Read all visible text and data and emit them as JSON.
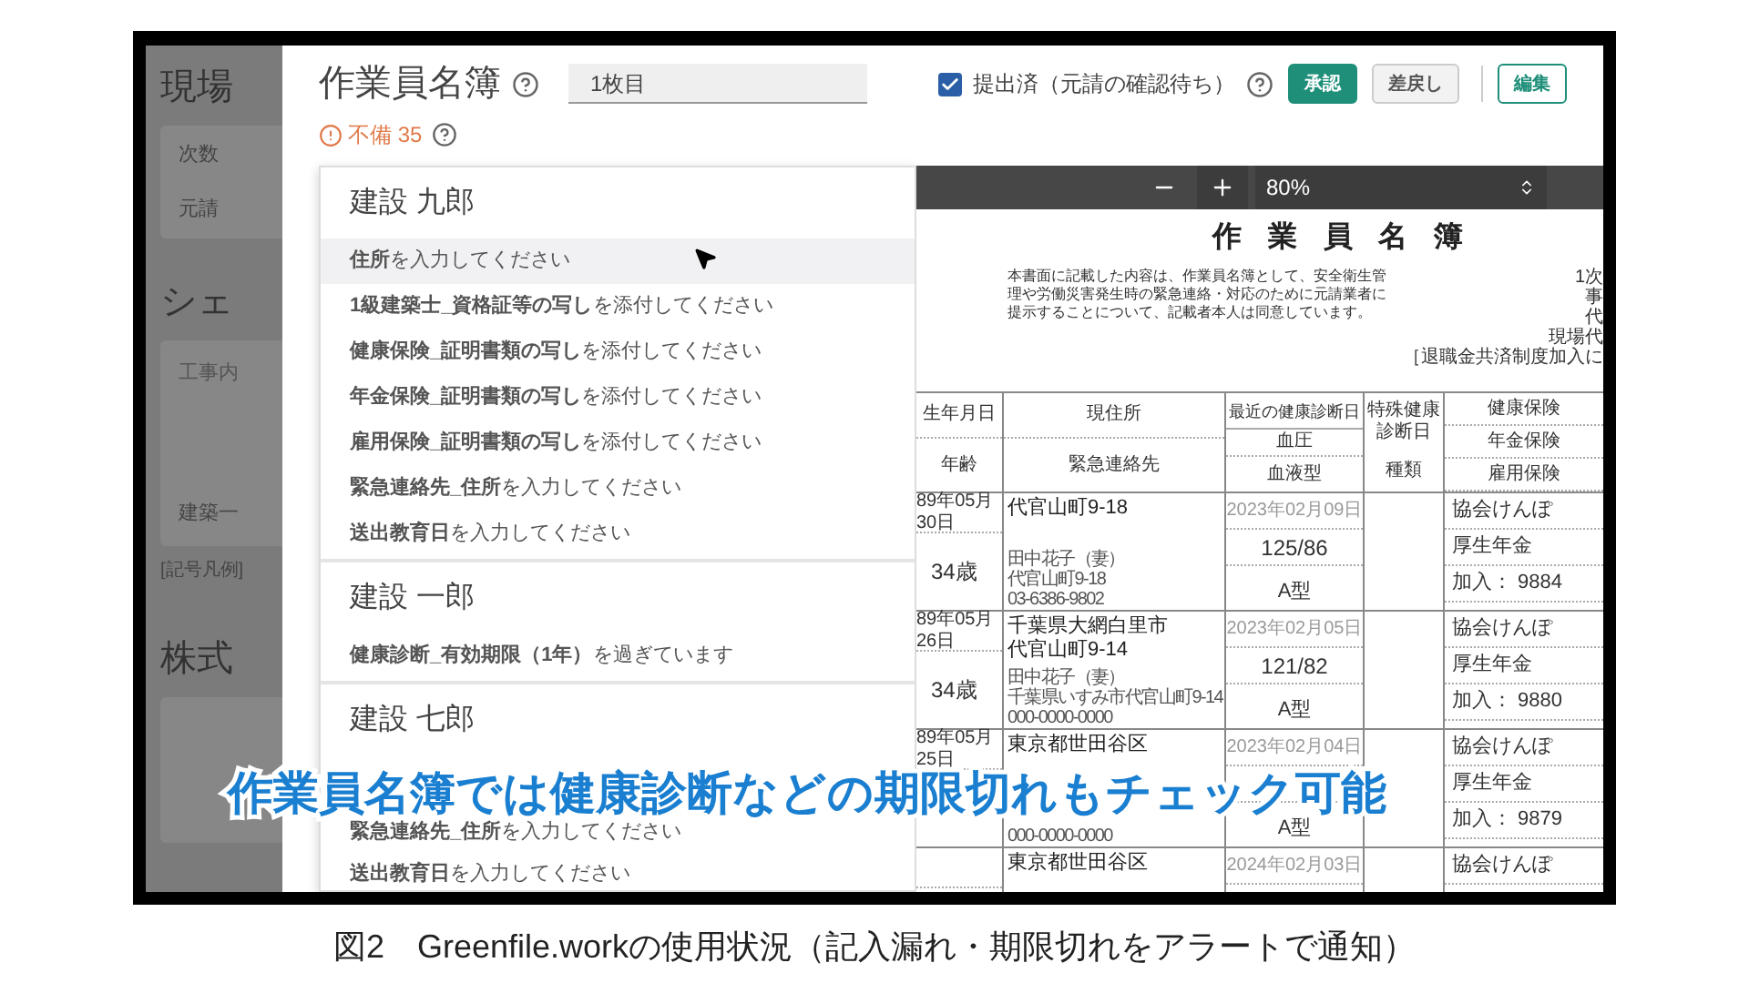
{
  "background_page": {
    "heading": "現場",
    "rows": [
      "次数",
      "元請"
    ],
    "section": "シェ",
    "field": "工事内",
    "field_value": "建築一",
    "legend": "[記号凡例]",
    "heading_2": "株式"
  },
  "dialog": {
    "title": "作業員名簿",
    "sheet": {
      "value": "1枚目"
    },
    "submitted": {
      "label": "提出済（元請の確認待ち）",
      "checked": true
    },
    "buttons": [
      {
        "label": "承認",
        "kind": "primary"
      },
      {
        "label": "差戻し",
        "kind": "secondary"
      },
      {
        "label": "編集",
        "kind": "outline"
      }
    ],
    "deficiency": {
      "label": "不備 35"
    }
  },
  "issues_popover": {
    "workers": [
      {
        "name": "建設 九郎",
        "issues": [
          {
            "text": "**住所**を入力してください",
            "highlighted": true
          },
          {
            "text": "**1級建築士_資格証等の写し**を添付してください",
            "highlighted": false
          },
          {
            "text": "**健康保険_証明書類の写し**を添付してください",
            "highlighted": false
          },
          {
            "text": "**年金保険_証明書類の写し**を添付してください",
            "highlighted": false
          },
          {
            "text": "**雇用保険_証明書類の写し**を添付してください",
            "highlighted": false
          },
          {
            "text": "**緊急連絡先_住所**を入力してください",
            "highlighted": false
          },
          {
            "text": "**送出教育日**を入力してください",
            "highlighted": false
          }
        ]
      },
      {
        "name": "建設 一郎",
        "issues": [
          {
            "text": "**健康診断_有効期限（1年）**を過ぎています",
            "highlighted": false
          }
        ]
      },
      {
        "name": "建設 七郎",
        "issues": [
          {
            "text": "**緊急連絡先_住所**を入力してください",
            "highlighted": false
          },
          {
            "text": "**送出教育日**を入力してください",
            "highlighted": false
          }
        ]
      }
    ]
  },
  "viewer": {
    "zoom": "80%",
    "document": {
      "title": "作業員名簿",
      "notice": "本書面に記載した内容は、作業員名簿として、安全衛生管理や労働災害発生時の緊急連絡・対応のために元請業者に提示することについて、記載者本人は同意しています。",
      "side_labels": [
        "1次",
        "事",
        "代",
        "現場代",
        "［退職金共済制度加入に"
      ],
      "headers": {
        "birth": "生年月日",
        "age": "年齢",
        "address": "現住所",
        "contact": "緊急連絡先",
        "checkup": "最近の健康診断日",
        "blood_pressure": "血圧",
        "blood_type": "血液型",
        "special_checkup": "特殊健康診断日",
        "special_kind": "種類",
        "insurance": [
          "健康保険",
          "年金保険",
          "雇用保険"
        ]
      },
      "rows": [
        {
          "birth": "89年05月30日",
          "age": "34歳",
          "address": [
            "代官山町9-18"
          ],
          "contact": [
            "田中花子（妻）",
            "代官山町9-18",
            "03-6386-9802"
          ],
          "checkup": "2023年02月09日",
          "blood_pressure": "125/86",
          "blood_type": "A型",
          "insurance": [
            "協会けんぽ",
            "厚生年金",
            "加入： 9884"
          ]
        },
        {
          "birth": "89年05月26日",
          "age": "34歳",
          "address": [
            "千葉県大網白里市",
            "代官山町9-14"
          ],
          "contact": [
            "田中花子（妻）",
            "千葉県いすみ市代官山町9-14",
            "000-0000-0000"
          ],
          "checkup": "2023年02月05日",
          "blood_pressure": "121/82",
          "blood_type": "A型",
          "insurance": [
            "協会けんぽ",
            "厚生年金",
            "加入： 9880"
          ]
        },
        {
          "birth": "89年05月25日",
          "address": [
            "東京都世田谷区"
          ],
          "contact": [
            "000-0000-0000"
          ],
          "checkup": "2023年02月04日",
          "blood_type": "A型",
          "insurance": [
            "協会けんぽ",
            "厚生年金",
            "加入： 9879"
          ]
        },
        {
          "address": [
            "東京都世田谷区"
          ],
          "checkup": "2024年02月03日",
          "insurance": [
            "協会けんぽ"
          ]
        }
      ]
    }
  },
  "subtitle": "作業員名簿では健康診断などの期限切れもチェック可能",
  "caption": {
    "number": "図2",
    "text": "Greenfile.workの使用状況（記入漏れ・期限切れをアラートで通知）"
  }
}
